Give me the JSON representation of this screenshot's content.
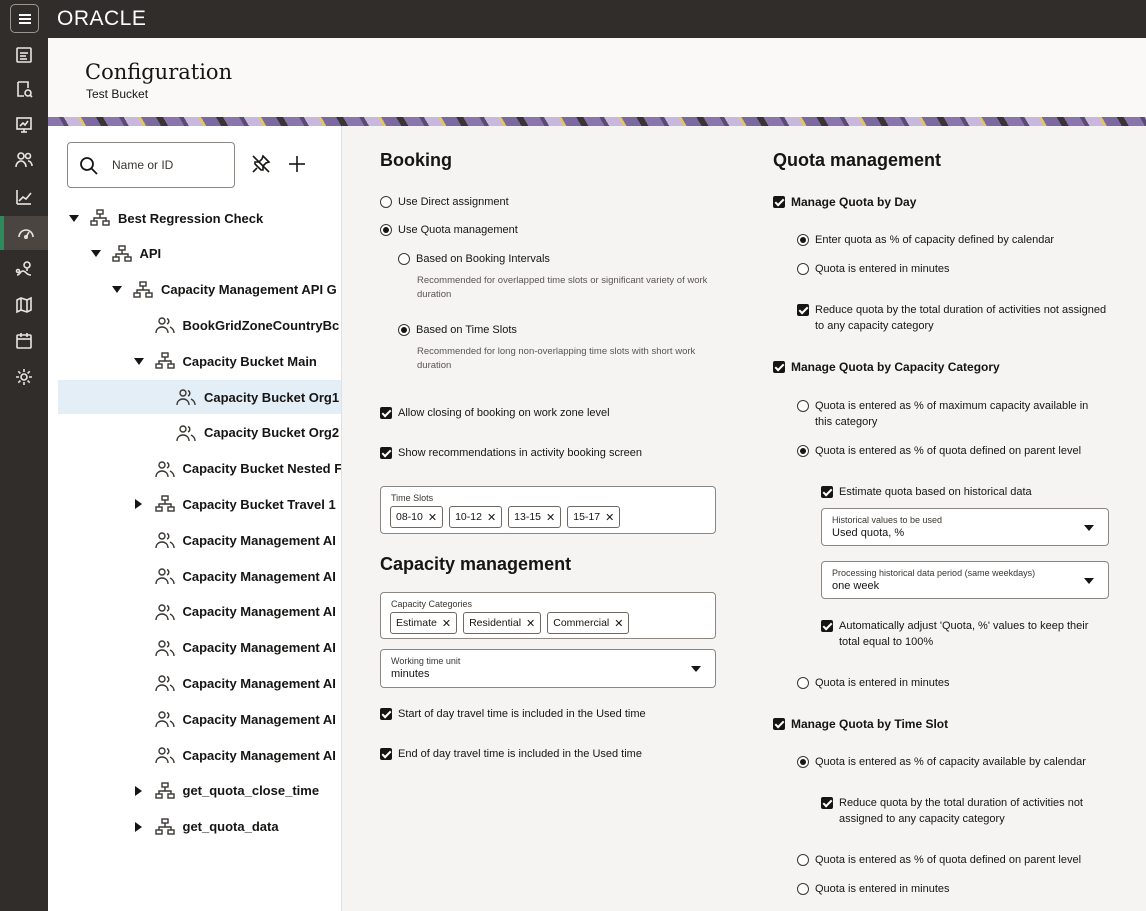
{
  "app": {
    "logo": "ORACLE"
  },
  "header": {
    "title": "Configuration",
    "subtitle": "Test Bucket"
  },
  "search": {
    "placeholder": "Name or ID"
  },
  "tree": [
    {
      "label": "Best Regression Check",
      "toggle": "down",
      "icon": "org-tree-icon"
    },
    {
      "label": "API",
      "toggle": "down",
      "icon": "org-tree-icon"
    },
    {
      "label": "Capacity Management API G",
      "toggle": "down",
      "icon": "org-tree-icon"
    },
    {
      "label": "BookGridZoneCountryBc",
      "toggle": "none",
      "icon": "people-icon"
    },
    {
      "label": "Capacity Bucket Main",
      "toggle": "down",
      "icon": "org-tree-icon"
    },
    {
      "label": "Capacity Bucket Org1",
      "toggle": "none",
      "icon": "people-icon",
      "selected": true
    },
    {
      "label": "Capacity Bucket Org2",
      "toggle": "none",
      "icon": "people-icon"
    },
    {
      "label": "Capacity Bucket Nested F",
      "toggle": "none",
      "icon": "people-icon"
    },
    {
      "label": "Capacity Bucket Travel 1",
      "toggle": "right",
      "icon": "org-tree-icon"
    },
    {
      "label": "Capacity Management AI",
      "toggle": "none",
      "icon": "people-icon"
    },
    {
      "label": "Capacity Management AI",
      "toggle": "none",
      "icon": "people-icon"
    },
    {
      "label": "Capacity Management AI",
      "toggle": "none",
      "icon": "people-icon"
    },
    {
      "label": "Capacity Management AI",
      "toggle": "none",
      "icon": "people-icon"
    },
    {
      "label": "Capacity Management AI",
      "toggle": "none",
      "icon": "people-icon"
    },
    {
      "label": "Capacity Management AI",
      "toggle": "none",
      "icon": "people-icon"
    },
    {
      "label": "Capacity Management AI",
      "toggle": "none",
      "icon": "people-icon"
    },
    {
      "label": "get_quota_close_time",
      "toggle": "right",
      "icon": "org-tree-icon"
    },
    {
      "label": "get_quota_data",
      "toggle": "right",
      "icon": "org-tree-icon"
    }
  ],
  "booking": {
    "title": "Booking",
    "direct": "Use Direct assignment",
    "quota": "Use Quota management",
    "intervals": "Based on Booking Intervals",
    "intervals_hint": "Recommended for overlapped time slots or significant variety of work duration",
    "slots": "Based on Time Slots",
    "slots_hint": "Recommended for long non-overlapping time slots with short work duration",
    "allow_closing": "Allow closing of booking on work zone level",
    "show_recs": "Show recommendations in activity booking screen",
    "time_slots_label": "Time Slots",
    "time_slots": [
      "08-10",
      "10-12",
      "13-15",
      "15-17"
    ]
  },
  "capacity": {
    "title": "Capacity management",
    "categories_label": "Capacity Categories",
    "categories": [
      "Estimate",
      "Residential",
      "Commercial"
    ],
    "unit_label": "Working time unit",
    "unit_value": "minutes",
    "start_travel": "Start of day travel time is included in the Used time",
    "end_travel": "End of day travel time is included in the Used time"
  },
  "quota": {
    "title": "Quota management",
    "by_day": "Manage Quota by Day",
    "day_pct": "Enter quota as % of capacity defined by calendar",
    "day_min": "Quota is entered in minutes",
    "day_reduce": "Reduce quota by the total duration of activities not assigned to any capacity category",
    "by_cat": "Manage Quota by Capacity Category",
    "cat_max": "Quota is entered as % of maximum capacity available in this category",
    "cat_parent": "Quota is entered as % of quota defined on parent level",
    "estimate_hist": "Estimate quota based on historical data",
    "hist_values_label": "Historical values to be used",
    "hist_values_value": "Used quota, %",
    "hist_period_label": "Processing historical data period (same weekdays)",
    "hist_period_value": "one week",
    "auto_adjust": "Automatically adjust 'Quota, %' values to keep their total equal to 100%",
    "cat_min": "Quota is entered in minutes",
    "by_slot": "Manage Quota by Time Slot",
    "slot_cal": "Quota is entered as % of capacity available by calendar",
    "slot_reduce": "Reduce quota by the total duration of activities not assigned to any capacity category",
    "slot_parent": "Quota is entered as % of quota defined on parent level",
    "slot_min": "Quota is entered in minutes"
  }
}
